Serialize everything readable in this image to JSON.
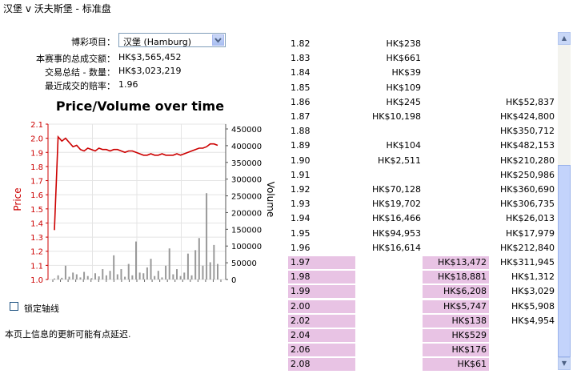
{
  "window": {
    "title": "汉堡 v 沃夫斯堡 - 标准盘"
  },
  "info": {
    "market_label": "博彩项目：",
    "market_value": "汉堡 (Hamburg)",
    "total_matched_label": "本赛事的总成交额：",
    "total_matched_value": "HK$3,565,452",
    "selection_matched_label": "交易总结 - 数量：",
    "selection_matched_value": "HK$3,023,219",
    "last_price_label": "最近成交的赔率：",
    "last_price_value": "1.96"
  },
  "chart_data": {
    "type": "line",
    "title": "Price/Volume over time",
    "ylabel": "Price",
    "y2label": "Volume",
    "ylim": [
      1.0,
      2.1
    ],
    "y2lim": [
      0,
      450000
    ],
    "yticks": [
      "2.1",
      "2.0",
      "1.9",
      "1.8",
      "1.7",
      "1.6",
      "1.5",
      "1.4",
      "1.3",
      "1.2",
      "1.1",
      "1.0"
    ],
    "y2ticks": [
      "450000",
      "400000",
      "350000",
      "300000",
      "250000",
      "200000",
      "150000",
      "100000",
      "50000",
      "0"
    ],
    "series": [
      {
        "name": "Price",
        "color": "#cc0000",
        "values": [
          1.35,
          2.01,
          1.98,
          2.0,
          1.97,
          1.94,
          1.95,
          1.92,
          1.91,
          1.93,
          1.92,
          1.91,
          1.93,
          1.92,
          1.92,
          1.91,
          1.92,
          1.92,
          1.91,
          1.9,
          1.91,
          1.91,
          1.9,
          1.89,
          1.88,
          1.88,
          1.89,
          1.88,
          1.88,
          1.89,
          1.88,
          1.88,
          1.88,
          1.89,
          1.88,
          1.89,
          1.9,
          1.91,
          1.92,
          1.93,
          1.93,
          1.94,
          1.96,
          1.96,
          1.95
        ]
      },
      {
        "name": "Volume",
        "color": "#999999",
        "values": [
          3000,
          12000,
          5000,
          40000,
          8000,
          20000,
          15000,
          6000,
          22000,
          10000,
          4000,
          18000,
          9000,
          30000,
          12000,
          25000,
          70000,
          15000,
          30000,
          8000,
          45000,
          12000,
          110000,
          20000,
          18000,
          35000,
          60000,
          10000,
          25000,
          6000,
          40000,
          90000,
          15000,
          30000,
          10000,
          20000,
          75000,
          12000,
          85000,
          120000,
          40000,
          250000,
          50000,
          100000,
          45000
        ]
      }
    ]
  },
  "lock_axis": {
    "label": "锁定轴线",
    "checked": false
  },
  "notice": "本页上信息的更新可能有点延迟.",
  "ladder": [
    {
      "price": "1.82",
      "back": "HK$238",
      "lay": "",
      "lay_vol": "",
      "pink": false
    },
    {
      "price": "1.83",
      "back": "HK$661",
      "lay": "",
      "lay_vol": "",
      "pink": false
    },
    {
      "price": "1.84",
      "back": "HK$39",
      "lay": "",
      "lay_vol": "",
      "pink": false
    },
    {
      "price": "1.85",
      "back": "HK$109",
      "lay": "",
      "lay_vol": "",
      "pink": false
    },
    {
      "price": "1.86",
      "back": "HK$245",
      "lay": "",
      "lay_vol": "HK$52,837",
      "pink": false
    },
    {
      "price": "1.87",
      "back": "HK$10,198",
      "lay": "",
      "lay_vol": "HK$424,800",
      "pink": false
    },
    {
      "price": "1.88",
      "back": "",
      "lay": "",
      "lay_vol": "HK$350,712",
      "pink": false
    },
    {
      "price": "1.89",
      "back": "HK$104",
      "lay": "",
      "lay_vol": "HK$482,153",
      "pink": false
    },
    {
      "price": "1.90",
      "back": "HK$2,511",
      "lay": "",
      "lay_vol": "HK$210,280",
      "pink": false
    },
    {
      "price": "1.91",
      "back": "",
      "lay": "",
      "lay_vol": "HK$250,986",
      "pink": false
    },
    {
      "price": "1.92",
      "back": "HK$70,128",
      "lay": "",
      "lay_vol": "HK$360,690",
      "pink": false
    },
    {
      "price": "1.93",
      "back": "HK$19,702",
      "lay": "",
      "lay_vol": "HK$306,735",
      "pink": false
    },
    {
      "price": "1.94",
      "back": "HK$16,466",
      "lay": "",
      "lay_vol": "HK$26,013",
      "pink": false
    },
    {
      "price": "1.95",
      "back": "HK$94,953",
      "lay": "",
      "lay_vol": "HK$17,979",
      "pink": false
    },
    {
      "price": "1.96",
      "back": "HK$16,614",
      "lay": "",
      "lay_vol": "HK$212,840",
      "pink": false
    },
    {
      "price": "1.97",
      "back": "",
      "lay": "HK$13,472",
      "lay_vol": "HK$311,945",
      "pink": true
    },
    {
      "price": "1.98",
      "back": "",
      "lay": "HK$18,881",
      "lay_vol": "HK$1,312",
      "pink": true
    },
    {
      "price": "1.99",
      "back": "",
      "lay": "HK$6,208",
      "lay_vol": "HK$3,029",
      "pink": true
    },
    {
      "price": "2.00",
      "back": "",
      "lay": "HK$5,747",
      "lay_vol": "HK$5,908",
      "pink": true
    },
    {
      "price": "2.02",
      "back": "",
      "lay": "HK$138",
      "lay_vol": "HK$4,954",
      "pink": true
    },
    {
      "price": "2.04",
      "back": "",
      "lay": "HK$529",
      "lay_vol": "",
      "pink": true
    },
    {
      "price": "2.06",
      "back": "",
      "lay": "HK$176",
      "lay_vol": "",
      "pink": true
    },
    {
      "price": "2.08",
      "back": "",
      "lay": "HK$61",
      "lay_vol": "",
      "pink": true
    }
  ],
  "scrollbar": {
    "up_icon": "triangle-up",
    "down_icon": "triangle-down"
  }
}
